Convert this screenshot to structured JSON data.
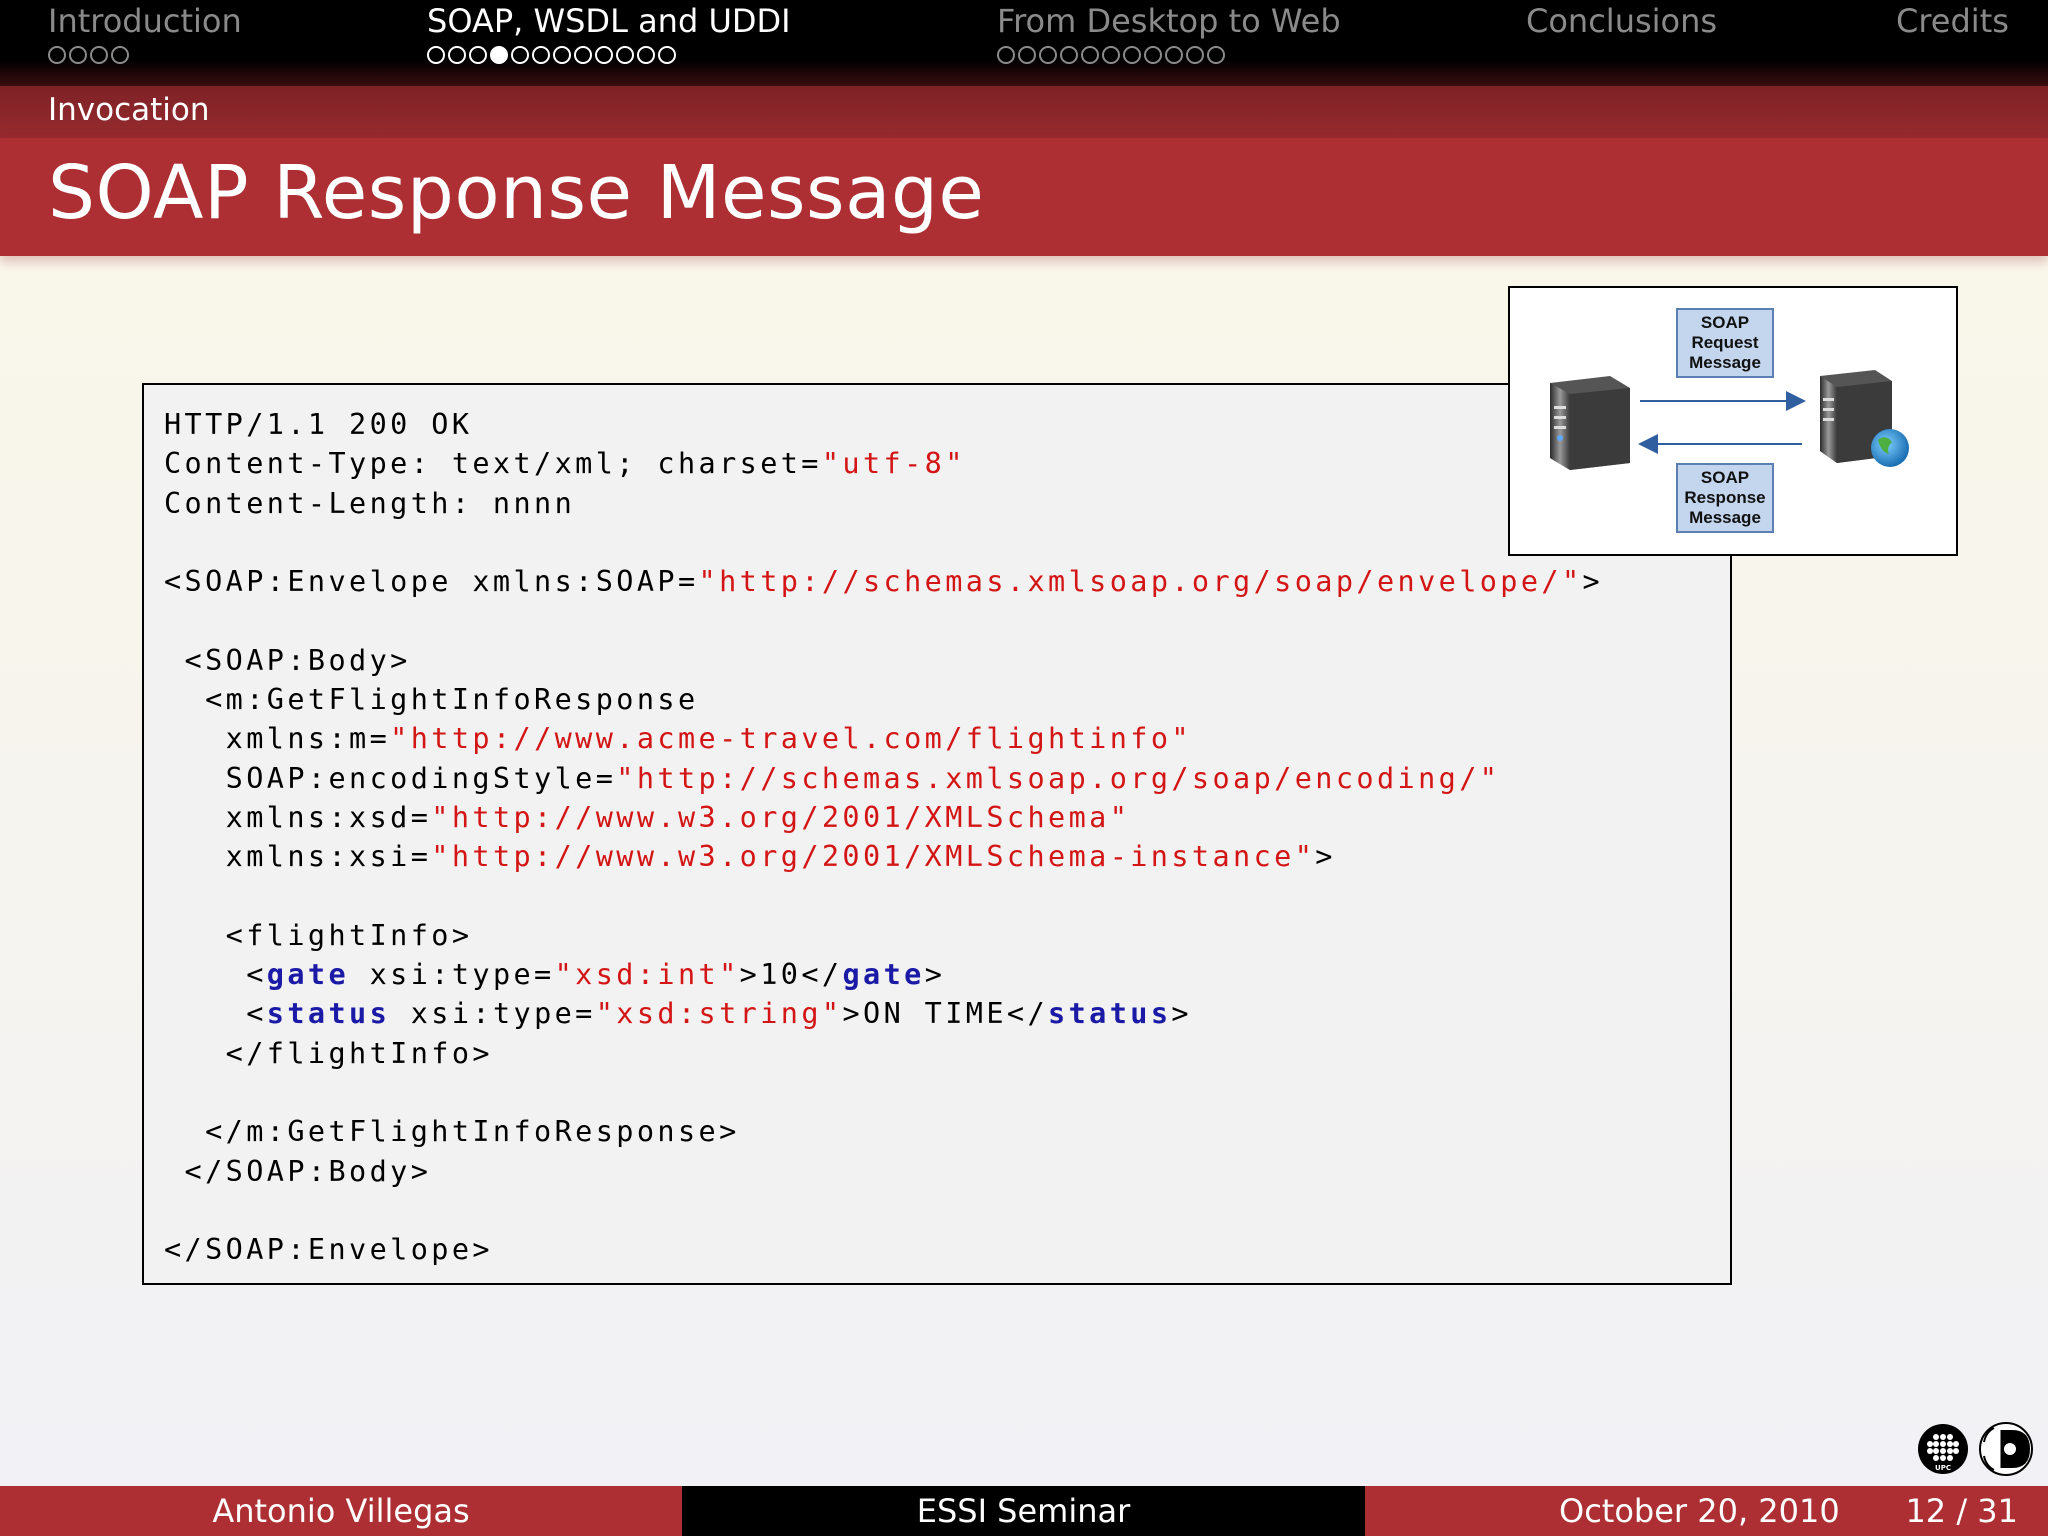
{
  "nav": {
    "sections": [
      {
        "label": "Introduction",
        "dots": 4,
        "filled": -1,
        "active": false
      },
      {
        "label": "SOAP, WSDL and UDDI",
        "dots": 12,
        "filled": 3,
        "active": true
      },
      {
        "label": "From Desktop to Web",
        "dots": 11,
        "filled": -1,
        "active": false
      },
      {
        "label": "Conclusions",
        "dots": 0,
        "filled": -1,
        "active": false
      },
      {
        "label": "Credits",
        "dots": 0,
        "filled": -1,
        "active": false
      }
    ]
  },
  "subsection": "Invocation",
  "slide_title": "SOAP Response Message",
  "code": {
    "l1": "HTTP/1.1 200 OK",
    "l2a": "Content-Type: text/xml; charset=",
    "l2b": "\"utf-8\"",
    "l3": "Content-Length: nnnn",
    "l5a": "<SOAP:Envelope xmlns:SOAP=",
    "l5b": "\"http://schemas.xmlsoap.org/soap/envelope/\"",
    "l5c": ">",
    "l7": " <SOAP:Body>",
    "l8": "  <m:GetFlightInfoResponse",
    "l9a": "   xmlns:m=",
    "l9b": "\"http://www.acme-travel.com/flightinfo\"",
    "l10a": "   SOAP:encodingStyle=",
    "l10b": "\"http://schemas.xmlsoap.org/soap/encoding/\"",
    "l11a": "   xmlns:xsd=",
    "l11b": "\"http://www.w3.org/2001/XMLSchema\"",
    "l12a": "   xmlns:xsi=",
    "l12b": "\"http://www.w3.org/2001/XMLSchema-instance\"",
    "l12c": ">",
    "l14": "   <flightInfo>",
    "l15a": "    <",
    "l15b": "gate",
    "l15c": " xsi:type=",
    "l15d": "\"xsd:int\"",
    "l15e": ">10</",
    "l15f": "gate",
    "l15g": ">",
    "l16a": "    <",
    "l16b": "status",
    "l16c": " xsi:type=",
    "l16d": "\"xsd:string\"",
    "l16e": ">ON TIME</",
    "l16f": "status",
    "l16g": ">",
    "l17": "   </flightInfo>",
    "l19": "  </m:GetFlightInfoResponse>",
    "l20": " </SOAP:Body>",
    "l22": "</SOAP:Envelope>"
  },
  "diagram": {
    "request_lines": [
      "SOAP",
      "Request",
      "Message"
    ],
    "response_lines": [
      "SOAP",
      "Response",
      "Message"
    ]
  },
  "footer": {
    "author": "Antonio Villegas",
    "event": "ESSI Seminar",
    "date": "October 20, 2010",
    "page": "12 / 31"
  },
  "logos": {
    "left": "UPC",
    "right": "DOCTORATE"
  },
  "colors": {
    "accent": "#ad2f33",
    "string": "#d41515",
    "keyword": "#1a1aa6"
  }
}
